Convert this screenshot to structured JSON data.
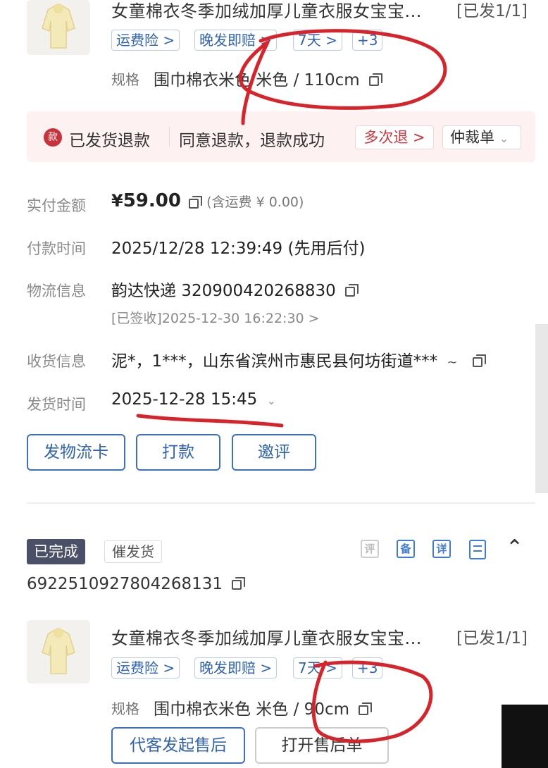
{
  "order1": {
    "product_title": "女童棉衣冬季加绒加厚儿童衣服女宝宝...",
    "ship_tag": "[已发1/1]",
    "tags": [
      "运费险 >",
      "晚发即赔 >",
      "7天 >",
      "+3"
    ],
    "spec_label": "规格",
    "spec_value": "围巾棉衣米色 米色 / 110cm",
    "refund": {
      "badge": "款",
      "status": "已发货退款",
      "detail": "同意退款，退款成功",
      "multi": "多次退 >",
      "arbitration": "仲裁单"
    },
    "rows": [
      {
        "label": "实付金额",
        "prefix": "¥",
        "value": "59.00",
        "extra": "(含运费 ¥ 0.00)"
      },
      {
        "label": "付款时间",
        "value": "2025/12/28 12:39:49 (先用后付)"
      },
      {
        "label": "物流信息",
        "value": "韵达快递 320900420268830",
        "sub": "[已签收]2025-12-30 16:22:30 >"
      },
      {
        "label": "收货信息",
        "value": "泥*，1***，山东省滨州市惠民县何坊街道***"
      },
      {
        "label": "发货时间",
        "value": "2025-12-28 15:45"
      }
    ],
    "buttons": [
      "发物流卡",
      "打款",
      "邀评"
    ]
  },
  "order2": {
    "status_badge": "已完成",
    "urge_tag": "催发货",
    "icons": [
      "评",
      "备",
      "详"
    ],
    "order_id": "6922510927804268131",
    "product_title": "女童棉衣冬季加绒加厚儿童衣服女宝宝...",
    "ship_tag": "[已发1/1]",
    "tags": [
      "运费险 >",
      "晚发即赔 >",
      "7天 >",
      "+3"
    ],
    "spec_label": "规格",
    "spec_value": "围巾棉衣米色 米色 / 90cm",
    "buttons": [
      "代客发起售后",
      "打开售后单"
    ]
  },
  "colors": {
    "accent_blue": "#2f63b8",
    "refund_bg": "#fdf1f2",
    "annotation_red": "#d8232a",
    "status_badge_bg": "#4a5068"
  }
}
